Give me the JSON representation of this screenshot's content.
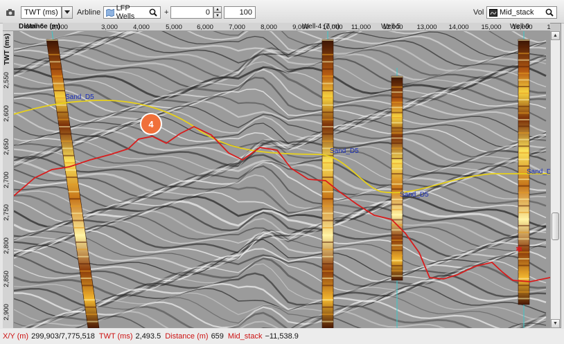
{
  "toolbar": {
    "camera_icon": "camera-icon",
    "domain_value": "TWT (ms)",
    "arbline_label": "Arbline",
    "wells_value": "LFP Wells",
    "plus_label": "+",
    "offset_value": "0",
    "percent_value": "100",
    "vol_label": "Vol",
    "volume_value": "Mid_stack"
  },
  "axes": {
    "x_title": "Distance (m)",
    "y_title": "TWT (ms)",
    "x_ticks": [
      "2,000",
      "3,000",
      "4,000",
      "5,000",
      "6,000",
      "7,000",
      "8,000",
      "9,000",
      "10,000",
      "11,000",
      "12,000",
      "13,000",
      "14,000",
      "15,000",
      "16,000",
      "1"
    ],
    "y_ticks": [
      "2,550",
      "2,600",
      "2,650",
      "2,700",
      "2,750",
      "2,800",
      "2,850",
      "2,900"
    ]
  },
  "wells": [
    {
      "label": "Well-6"
    },
    {
      "label": "Well-4 (7 m)"
    },
    {
      "label": "Well-5"
    },
    {
      "label": "Well-9"
    }
  ],
  "horizon": {
    "labels": [
      "Sand_D5",
      "Sand_D5",
      "Sand_D5",
      "Sand_D"
    ],
    "yellow": "#e8d11a",
    "red": "#d81c1c",
    "label_color": "#1b2fb8"
  },
  "callout": {
    "number": "4",
    "color": "#f0703a"
  },
  "status": {
    "xy_key": "X/Y (m)",
    "xy_val": "299,903/7,775,518",
    "twt_key": "TWT (ms)",
    "twt_val": "2,493.5",
    "dist_key": "Distance (m)",
    "dist_val": "659",
    "vol_key": "Mid_stack",
    "vol_val": "−11,538.9"
  }
}
